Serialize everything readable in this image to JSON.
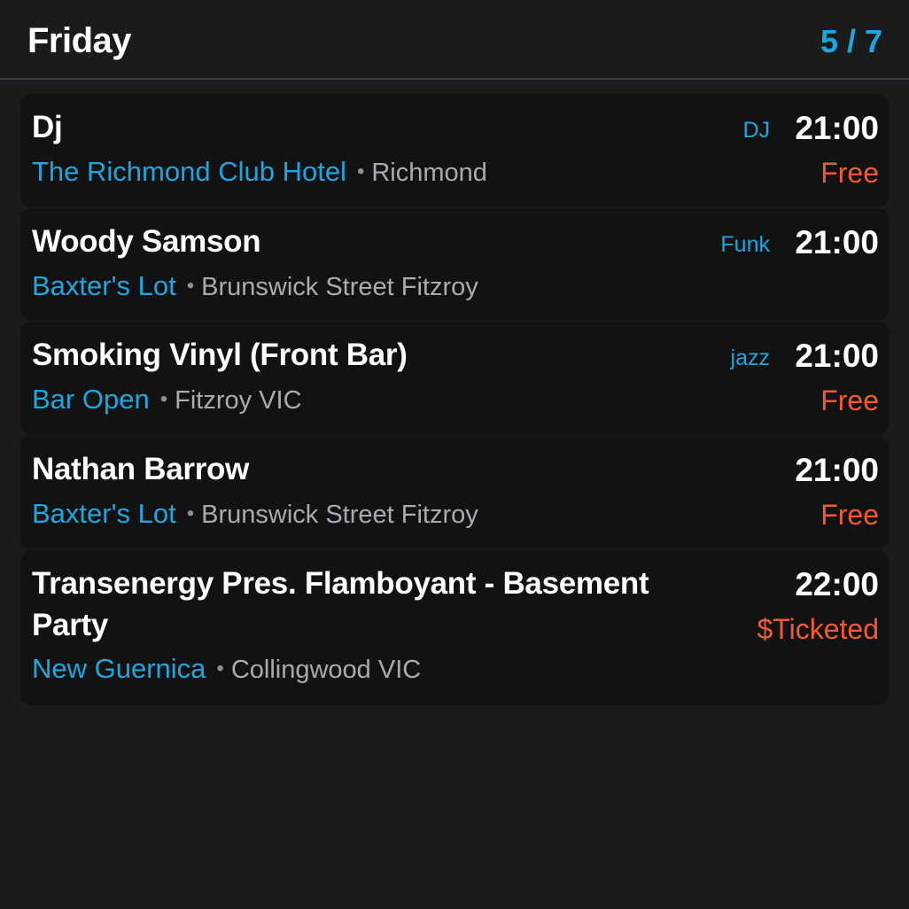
{
  "header": {
    "day": "Friday",
    "page": "5 / 7"
  },
  "events": [
    {
      "name": "Dj",
      "venue": "The Richmond Club Hotel",
      "location": "Richmond",
      "genre": "DJ",
      "time": "21:00",
      "price": "Free"
    },
    {
      "name": "Woody Samson",
      "venue": "Baxter's Lot",
      "location": "Brunswick Street Fitzroy",
      "genre": "Funk",
      "time": "21:00",
      "price": ""
    },
    {
      "name": "Smoking Vinyl (Front Bar)",
      "venue": "Bar Open",
      "location": "Fitzroy VIC",
      "genre": "jazz",
      "time": "21:00",
      "price": "Free"
    },
    {
      "name": "Nathan Barrow",
      "venue": "Baxter's Lot",
      "location": "Brunswick Street Fitzroy",
      "genre": "",
      "time": "21:00",
      "price": "Free"
    },
    {
      "name": "Transenergy Pres. Flamboyant - Basement Party",
      "venue": "New Guernica",
      "location": "Collingwood VIC",
      "genre": "",
      "time": "22:00",
      "price": "$Ticketed"
    }
  ],
  "colors": {
    "accent": "#1ca7e0",
    "price": "#f15a35",
    "card": "#121212",
    "background": "#1b1b1c"
  },
  "separator": "•"
}
